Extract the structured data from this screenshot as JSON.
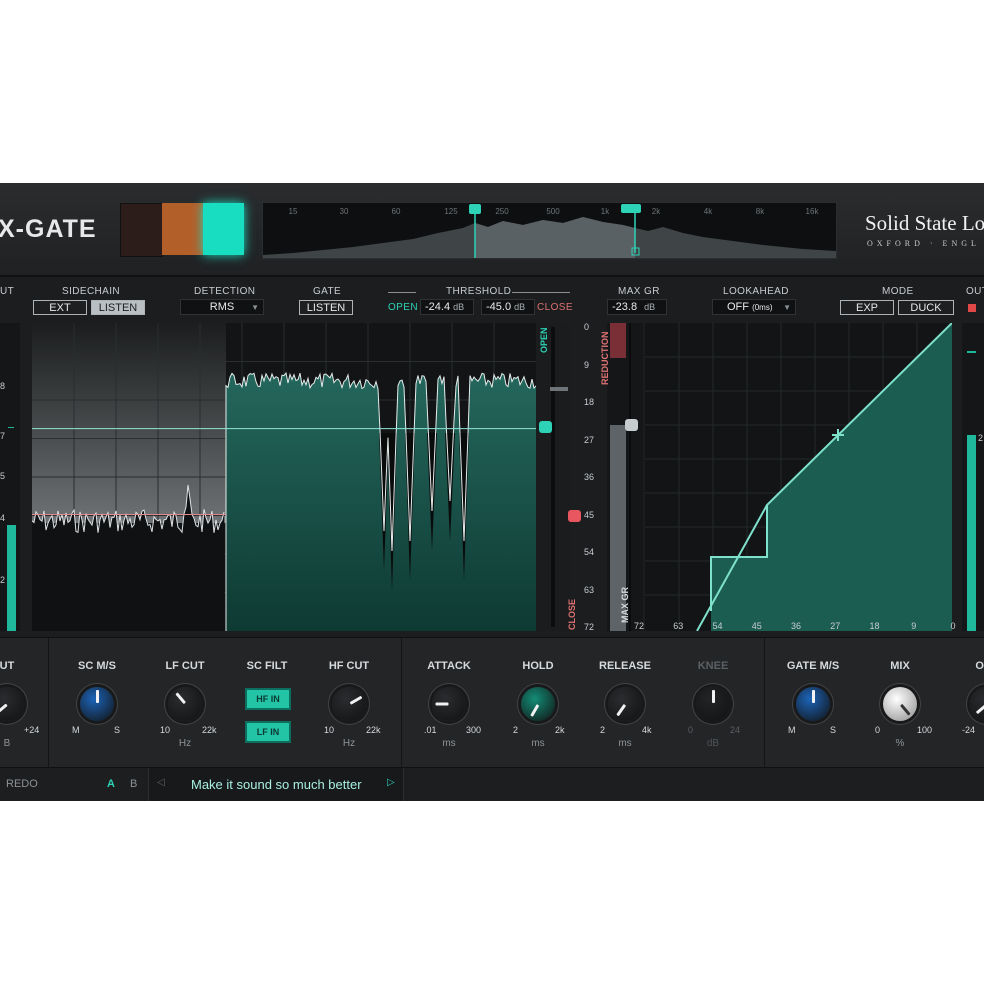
{
  "header": {
    "title": "X-GATE",
    "brand": "Solid State Lo",
    "brand_sub": "OXFORD · ENGL",
    "swatches": [
      "#2c1c1a",
      "#b35f2a",
      "#18ddc0"
    ],
    "spectrum_freqs": [
      "15",
      "30",
      "60",
      "125",
      "250",
      "500",
      "1k",
      "2k",
      "4k",
      "8k",
      "16k"
    ]
  },
  "controls": {
    "input_label": "UT",
    "sidechain": {
      "label": "SIDECHAIN",
      "ext": "EXT",
      "listen": "LISTEN"
    },
    "detection": {
      "label": "DETECTION",
      "value": "RMS"
    },
    "gate": {
      "label": "GATE",
      "listen": "LISTEN"
    },
    "threshold": {
      "label": "THRESHOLD",
      "open_label": "OPEN",
      "open_value": "-24.4",
      "open_unit": "dB",
      "close_value": "-45.0",
      "close_unit": "dB",
      "close_label": "CLOSE"
    },
    "max_gr": {
      "label": "MAX GR",
      "value": "-23.8",
      "unit": "dB"
    },
    "lookahead": {
      "label": "LOOKAHEAD",
      "value": "OFF",
      "sub": "(0ms)"
    },
    "mode": {
      "label": "MODE",
      "exp": "EXP",
      "duck": "DUCK"
    },
    "output_label": "OUT"
  },
  "display": {
    "open_label": "OPEN",
    "close_label": "CLOSE",
    "reduction_label": "REDUCTION",
    "maxgr_label": "MAX GR",
    "db_scale": [
      "0",
      "9",
      "18",
      "27",
      "36",
      "45",
      "54",
      "63",
      "72"
    ],
    "transfer_x_scale": [
      "72",
      "63",
      "54",
      "45",
      "36",
      "27",
      "18",
      "9",
      "0"
    ],
    "left_meter_marks": [
      "8",
      "7",
      "5",
      "4",
      "2"
    ],
    "right_meter_marks": [
      "2"
    ],
    "open_threshold_db": -24.4,
    "close_threshold_db": -45.0,
    "max_gr_db": -23.8
  },
  "knobs": {
    "input": {
      "label": "UT",
      "max": "+24",
      "unit": "B",
      "color": "#2a2c2f"
    },
    "sc_ms": {
      "label": "SC M/S",
      "min": "M",
      "max": "S",
      "color": "#1c64b8"
    },
    "lf_cut": {
      "label": "LF CUT",
      "min": "10",
      "max": "22k",
      "unit": "Hz",
      "color": "#2a2c2f"
    },
    "sc_filt": {
      "label": "SC FILT",
      "hf_in": "HF IN",
      "lf_in": "LF IN"
    },
    "hf_cut": {
      "label": "HF CUT",
      "min": "10",
      "max": "22k",
      "unit": "Hz",
      "color": "#2a2c2f"
    },
    "attack": {
      "label": "ATTACK",
      "min": ".01",
      "max": "300",
      "unit": "ms",
      "color": "#2a2c2f"
    },
    "hold": {
      "label": "HOLD",
      "min": "2",
      "max": "2k",
      "unit": "ms",
      "color": "#138c76"
    },
    "release": {
      "label": "RELEASE",
      "min": "2",
      "max": "4k",
      "unit": "ms",
      "color": "#2a2c2f"
    },
    "knee": {
      "label": "KNEE",
      "min": "0",
      "max": "24",
      "unit": "dB",
      "color": "#222426"
    },
    "gate_ms": {
      "label": "GATE M/S",
      "min": "M",
      "max": "S",
      "color": "#1c64b8"
    },
    "mix": {
      "label": "MIX",
      "min": "0",
      "max": "100",
      "unit": "%",
      "color": "#d8d8d8"
    },
    "output": {
      "label": "OUT",
      "min": "-24",
      "unit": "c",
      "color": "#2a2c2f"
    }
  },
  "footer": {
    "redo": "REDO",
    "a": "A",
    "b": "B",
    "preset": "Make it sound so much better"
  }
}
